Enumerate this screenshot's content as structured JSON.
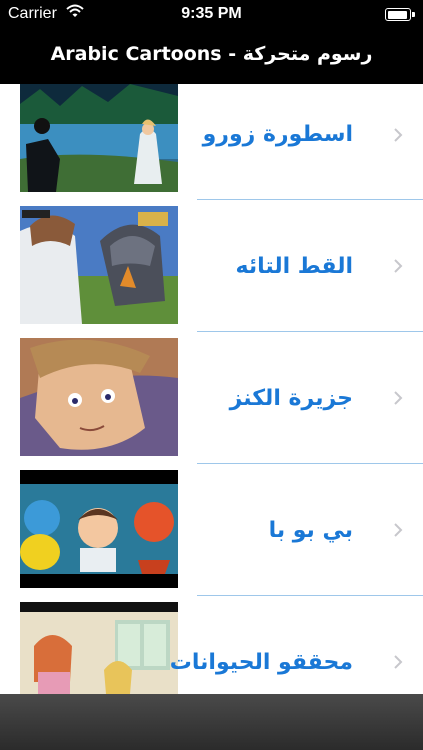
{
  "status_bar": {
    "carrier": "Carrier",
    "time": "9:35 PM"
  },
  "nav": {
    "title": "Arabic Cartoons - رسوم متحركة"
  },
  "list": {
    "items": [
      {
        "title": "اسطورة زورو",
        "thumbnail": "zorro-cartoon-thumbnail"
      },
      {
        "title": "القط التائه",
        "thumbnail": "lost-cat-cartoon-thumbnail"
      },
      {
        "title": "جزيرة الكنز",
        "thumbnail": "treasure-island-cartoon-thumbnail"
      },
      {
        "title": "بي بو با",
        "thumbnail": "bee-boo-ba-cartoon-thumbnail"
      },
      {
        "title": "محققو الحيوانات",
        "thumbnail": "animal-detectives-cartoon-thumbnail"
      }
    ]
  },
  "colors": {
    "accent": "#1a78d6",
    "bar": "#000000"
  }
}
